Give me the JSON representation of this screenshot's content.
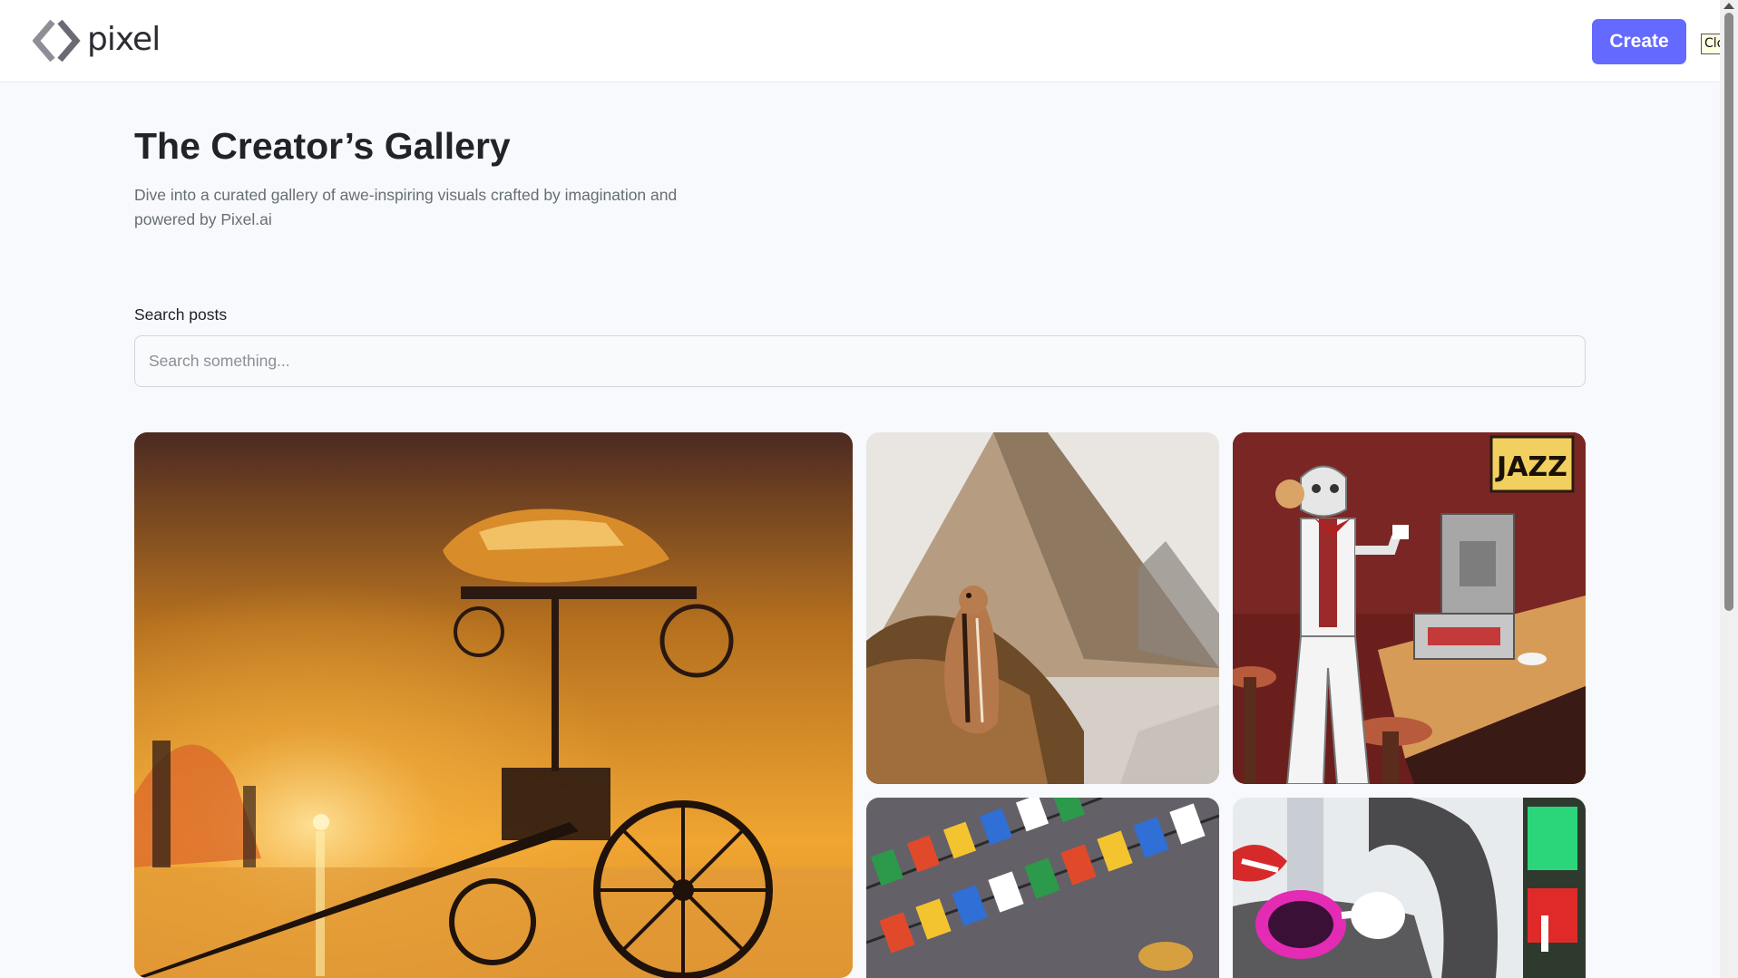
{
  "header": {
    "logo_text": "pixel",
    "create_label": "Create",
    "tooltip_text": "Close"
  },
  "hero": {
    "title": "The Creator’s Gallery",
    "subtitle": "Dive into a curated gallery of awe-inspiring visuals crafted by imagination and powered by Pixel.ai"
  },
  "search": {
    "label": "Search posts",
    "placeholder": "Search something...",
    "value": ""
  },
  "gallery": {
    "cards": [
      {
        "subject": "steampunk vehicle at sunset"
      },
      {
        "subject": "chipmunk at the pyramids"
      },
      {
        "subject": "robot barista jazz cafe",
        "sign_text": "JAZZ"
      },
      {
        "subject": "colorful prayer flags"
      },
      {
        "subject": "elephant with pink sunglasses"
      }
    ]
  },
  "colors": {
    "accent": "#6469ff",
    "background": "#f8f9fc",
    "title": "#222328",
    "subtitle": "#666e75"
  }
}
